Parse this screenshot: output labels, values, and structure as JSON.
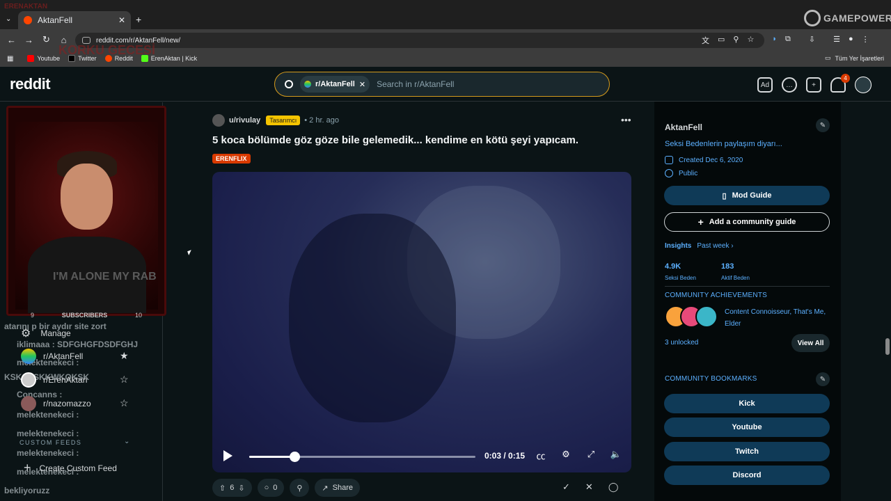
{
  "browser": {
    "tab_title": "AktanFell",
    "url": "reddit.com/r/AktanFell/new/",
    "bookmarks": [
      {
        "label": "Youtube",
        "color": "#ff0000"
      },
      {
        "label": "Twitter",
        "color": "#000000"
      },
      {
        "label": "Reddit",
        "color": "#ff4500"
      },
      {
        "label": "ErenAktan | Kick",
        "color": "#53fc18"
      }
    ],
    "bookmarks_all": "Tüm Yer İşaretleri"
  },
  "overlay": {
    "gamepower_logo": "GAMEPOWER",
    "stream_logo": "ERENAKTAN",
    "stream_big": "KORKU GECESİ",
    "webcam_stats": [
      "9",
      "SUBSCRIBERS",
      "10"
    ],
    "shirt_text": "I'M ALONE MY RAB",
    "chat": [
      {
        "text": "atarını p bir aydır site zort"
      },
      {
        "text": "iklimaaa : SDFGHGFDSDFGHJ"
      },
      {
        "text": "melektenekeci :"
      },
      {
        "text": "KSKSKSKKWKOKSK"
      },
      {
        "text": "Concanns :"
      },
      {
        "text": "melektenekeci :"
      },
      {
        "text": "melektenekeci :"
      },
      {
        "text": "melektenekeci :"
      },
      {
        "text": "melektenekeci :"
      },
      {
        "text": "bekliyoruzz"
      }
    ]
  },
  "header": {
    "logo": "reddit",
    "search_chip": "r/AktanFell",
    "search_placeholder": "Search in r/AktanFell",
    "notification_count": "4"
  },
  "left_nav": {
    "manage": "Manage",
    "communities": [
      {
        "name": "r/AktanFell",
        "starred": true
      },
      {
        "name": "r/ErenAktan",
        "starred": false
      },
      {
        "name": "r/nazomazzo",
        "starred": false
      }
    ],
    "custom_feeds_label": "CUSTOM FEEDS",
    "create_custom_feed": "Create Custom Feed"
  },
  "post": {
    "author": "u/rivulay",
    "author_flair": "Tasarımcı",
    "time": "• 2 hr. ago",
    "title": "5 koca bölümde göz göze bile gelemedik... kendime en kötü şeyi yapıcam.",
    "flair": "ERENFLIX",
    "video": {
      "time": "0:03 / 0:15",
      "progress": 0.2
    },
    "upvotes": "6",
    "comments": "0",
    "share": "Share"
  },
  "sidebar": {
    "community_name": "AktanFell",
    "description": "Seksi Bedenlerin paylaşım diyarı...",
    "created": "Created Dec 6, 2020",
    "visibility": "Public",
    "mod_guide": "Mod Guide",
    "add_guide": "Add a community guide",
    "insights_label": "Insights",
    "insights_period": "Past week",
    "stats": [
      {
        "value": "4.9K",
        "label": "Seksi Beden"
      },
      {
        "value": "183",
        "label": "Aktif Beden"
      }
    ],
    "achievements_title": "COMMUNITY ACHIEVEMENTS",
    "achievements_text": "Content Connoisseur, That's Me, Elder",
    "unlocked": "3 unlocked",
    "view_all": "View All",
    "bookmarks_title": "COMMUNITY BOOKMARKS",
    "bookmark_links": [
      "Kick",
      "Youtube",
      "Twitch",
      "Discord"
    ]
  },
  "colors": {
    "accent_blue": "#5cb0ff",
    "reddit_orange": "#ff4500",
    "flair_yellow": "#f5c400",
    "search_border": "#d49a1b",
    "button_blue": "#0f3a57"
  }
}
